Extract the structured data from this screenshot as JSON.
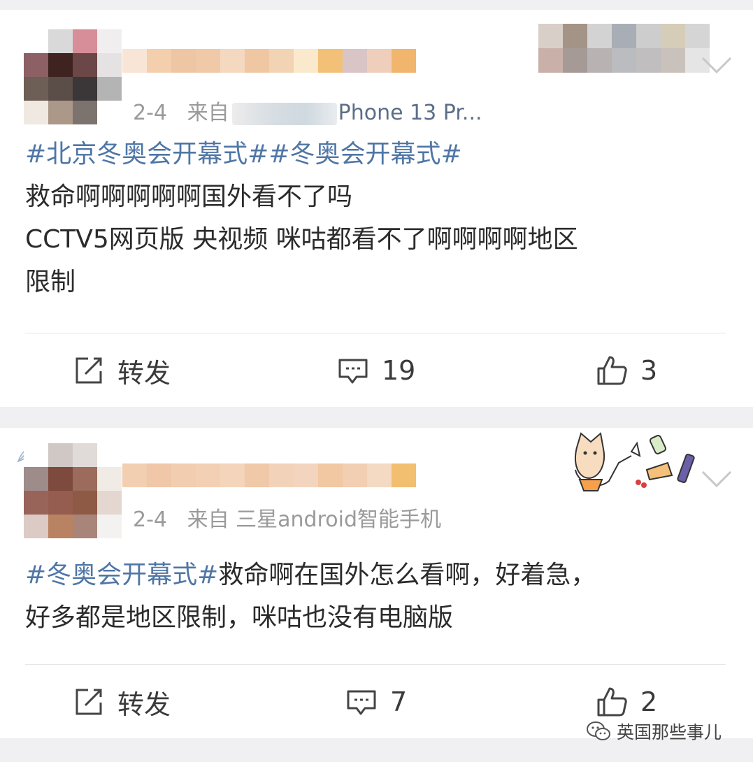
{
  "posts": [
    {
      "meta": {
        "date": "2-4",
        "from_label": "来自",
        "device": "Phone 13 Pr..."
      },
      "content": {
        "tag1": "#北京冬奥会开幕式#",
        "tag2": "#冬奥会开幕式#",
        "line1": "救命啊啊啊啊啊国外看不了吗",
        "line2": "CCTV5网页版 央视频 咪咕都看不了啊啊啊啊地区",
        "line3": "限制"
      },
      "actions": {
        "repost_label": "转发",
        "comment_count": "19",
        "like_count": "3"
      }
    },
    {
      "meta": {
        "date": "2-4",
        "from_label": "来自",
        "device": "三星android智能手机"
      },
      "content": {
        "tag1": "#冬奥会开幕式#",
        "line1": "救命啊在国外怎么看啊，好着急，",
        "line2": "好多都是地区限制，咪咕也没有电脑版"
      },
      "actions": {
        "repost_label": "转发",
        "comment_count": "7",
        "like_count": "2"
      }
    }
  ],
  "watermark": {
    "text": "英国那些事儿"
  },
  "icons": [
    "repost-icon",
    "comment-icon",
    "like-icon",
    "chevron-down-icon",
    "wechat-icon"
  ],
  "colors": {
    "tag": "#4f76a6",
    "text": "#2b2b2b",
    "meta": "#9a9a9a",
    "background": "#f0f0f2"
  }
}
